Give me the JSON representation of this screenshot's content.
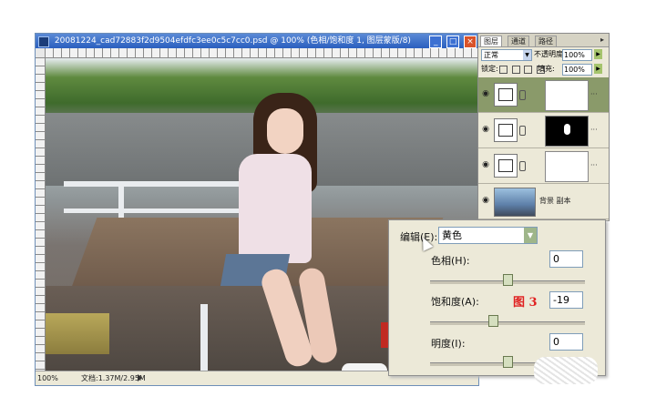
{
  "document": {
    "title": "20081224_cad72883f2d9504efdfc3ee0c5c7cc0.psd @ 100% (色相/饱和度 1, 图层蒙版/8)",
    "zoom": "100%",
    "doc_size": "文档:1.37M/2.95M",
    "window_buttons": [
      "_",
      "□",
      "×"
    ]
  },
  "layers_panel": {
    "tabs": [
      "图层",
      "通道",
      "路径"
    ],
    "active_tab": 0,
    "menu_icon": "panel-menu-icon",
    "blend_mode": "正常",
    "opacity_label": "不透明度:",
    "opacity_value": "100%",
    "lock_label": "锁定:",
    "fill_label": "填充:",
    "fill_value": "100%",
    "layers": [
      {
        "type": "adjustment",
        "mask": "white",
        "selected": true,
        "name": ""
      },
      {
        "type": "adjustment",
        "mask": "black",
        "selected": false,
        "name": ""
      },
      {
        "type": "adjustment",
        "mask": "white",
        "selected": false,
        "name": ""
      },
      {
        "type": "image",
        "name": "背景 副本",
        "selected": false
      }
    ]
  },
  "hue_dialog": {
    "edit_label": "编辑(E):",
    "edit_value": "黄色",
    "hue_label": "色相(H):",
    "hue_value": "0",
    "saturation_label": "饱和度(A):",
    "saturation_value": "-19",
    "lightness_label": "明度(I):",
    "lightness_value": "0",
    "figure_label": "图 3",
    "slider_positions": {
      "hue": 0,
      "saturation": -19,
      "lightness": 0
    }
  },
  "colors": {
    "title_bar": "#2a5fbf",
    "selected_layer": "#8a9a6a",
    "figure_label": "#e02020",
    "seal": "#c12a22"
  }
}
